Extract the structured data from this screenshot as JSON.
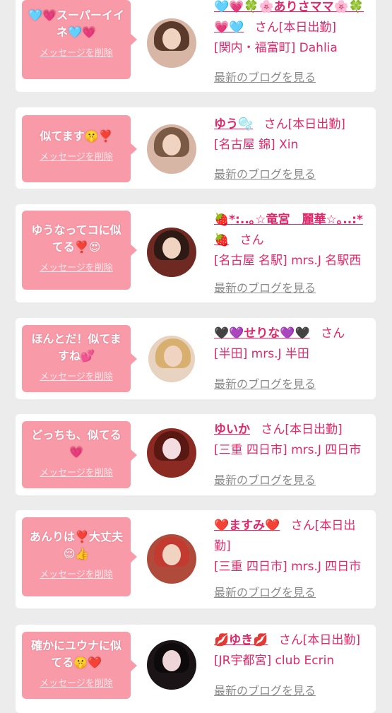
{
  "delete_label": "メッセージを削除",
  "blog_label": "最新のブログを見る",
  "san_label": "さん",
  "colors": {
    "accent": "#e0286a",
    "bubble": "#f89aa8",
    "card": "#ffffff",
    "background": "#ececec"
  },
  "items": [
    {
      "message": "🩵💗スーパーイイネ🩵💗",
      "name": "🩵💗🍀🌸ありさママ🌸🍀💗🩵",
      "status": "[本日出勤]",
      "shop": "[関内・福富町] Dahlia"
    },
    {
      "message": "似てます🤫❣️",
      "name": "ゆう🫧",
      "status": "[本日出勤]",
      "shop": "[名古屋 錦] Xin"
    },
    {
      "message": "ゆうなってコに似てる❣️😍",
      "name": "🍓*:..｡☆竜宮　麗華☆｡..:*🍓",
      "status": "",
      "shop": "[名古屋 名駅] mrs.J 名駅西"
    },
    {
      "message": "ほんとだ！似てますね💕",
      "name": "🖤💜せりな💜🖤",
      "status": "",
      "shop": "[半田] mrs.J 半田"
    },
    {
      "message": "どっちも、似てる💗",
      "name": "ゆいか",
      "status": "[本日出勤]",
      "shop": "[三重 四日市] mrs.J 四日市"
    },
    {
      "message": "あんりは❣️大丈夫😌👍",
      "name": "❤️ますみ❤️",
      "status": "[本日出勤]",
      "shop": "[三重 四日市] mrs.J 四日市"
    },
    {
      "message": "確かにユウナに似てる🤫❤️",
      "name": "💋ゆき💋",
      "status": "[本日出勤]",
      "shop": "[JR宇都宮] club Ecrin"
    }
  ]
}
